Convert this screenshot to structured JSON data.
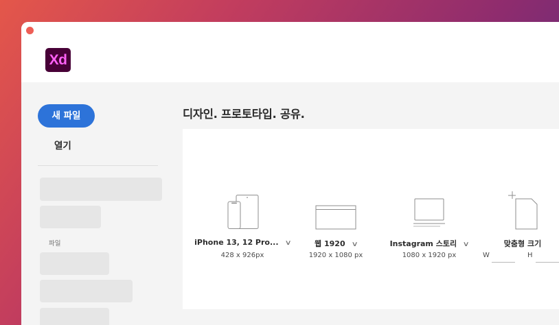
{
  "app": {
    "logo_text": "Xd"
  },
  "sidebar": {
    "new_file_label": "새 파일",
    "open_label": "열기",
    "files_section_label": "파일"
  },
  "main": {
    "headline": "디자인. 프로토타입. 공유.",
    "presets": [
      {
        "name": "iPhone 13, 12 Pro...",
        "size": "428 x 926px",
        "icon": "phone-tablet-icon"
      },
      {
        "name": "웹 1920",
        "size": "1920 x 1080 px",
        "icon": "browser-window-icon"
      },
      {
        "name": "Instagram 스토리",
        "size": "1080 x 1920 px",
        "icon": "laptop-icon"
      },
      {
        "name": "맞춤형 크기",
        "width_label": "W",
        "height_label": "H",
        "icon": "custom-document-icon"
      }
    ]
  },
  "colors": {
    "accent": "#2d73d9",
    "logo_bg": "#470137",
    "logo_text": "#ff61f6",
    "close_dot": "#ee5e56"
  }
}
